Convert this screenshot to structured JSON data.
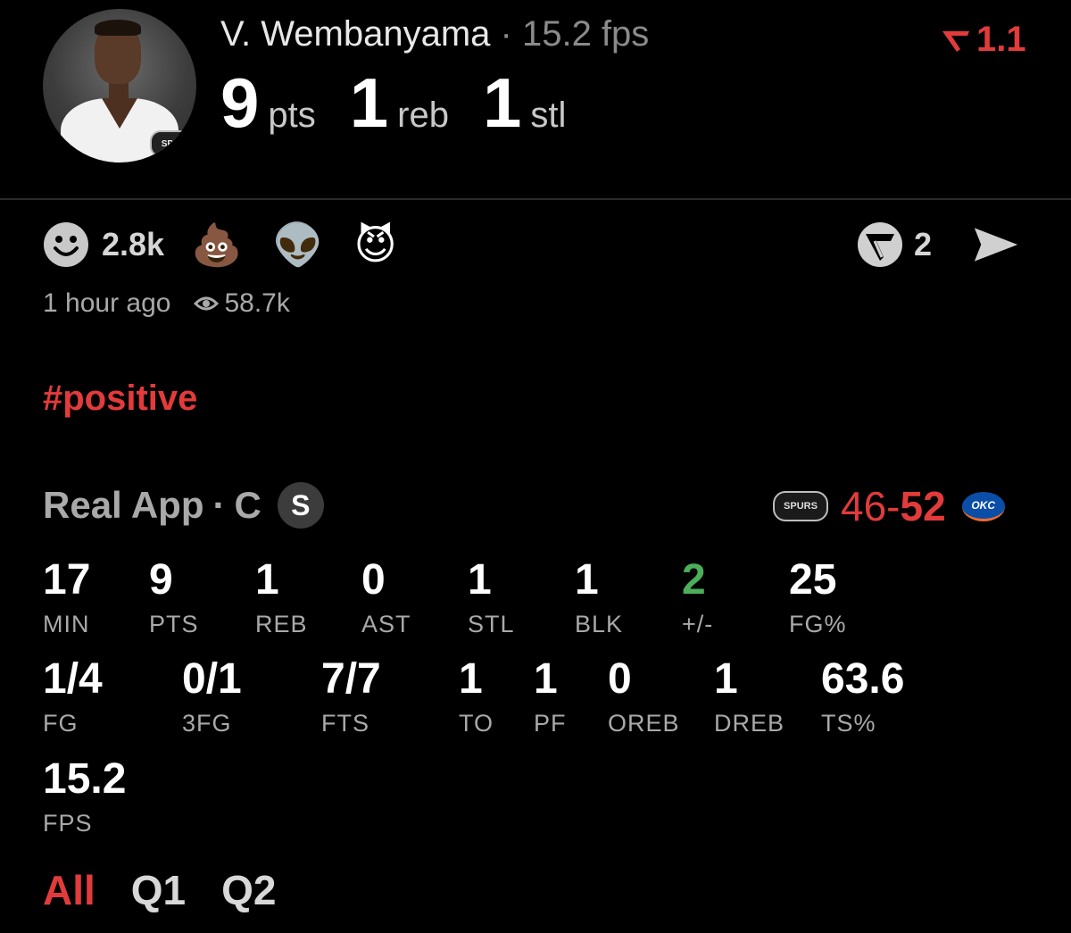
{
  "player": {
    "name": "V. Wembanyama",
    "separator": "·",
    "fps_text": "15.2 fps",
    "headline": [
      {
        "value": "9",
        "label": "pts"
      },
      {
        "value": "1",
        "label": "reb"
      },
      {
        "value": "1",
        "label": "stl"
      }
    ],
    "avatar_badge": "SPURS",
    "v_rating": "1.1"
  },
  "reactions": {
    "smiley_count": "2.8k",
    "emojis": [
      "💩",
      "👽",
      "😈"
    ],
    "share_count": "2",
    "timestamp": "1 hour ago",
    "views": "58.7k"
  },
  "post": {
    "hashtag": "#positive"
  },
  "game": {
    "source": "Real App",
    "separator": "·",
    "position": "C",
    "starter_badge": "S",
    "home_logo": "SPURS",
    "away_logo": "OKC",
    "score_left": "46",
    "score_dash": "-",
    "score_right": "52"
  },
  "stats_row1": [
    {
      "value": "17",
      "label": "MIN"
    },
    {
      "value": "9",
      "label": "PTS"
    },
    {
      "value": "1",
      "label": "REB"
    },
    {
      "value": "0",
      "label": "AST"
    },
    {
      "value": "1",
      "label": "STL"
    },
    {
      "value": "1",
      "label": "BLK"
    },
    {
      "value": "2",
      "label": "+/-"
    },
    {
      "value": "25",
      "label": "FG%"
    }
  ],
  "stats_row2": [
    {
      "value": "1/4",
      "label": "FG"
    },
    {
      "value": "0/1",
      "label": "3FG"
    },
    {
      "value": "7/7",
      "label": "FTS"
    },
    {
      "value": "1",
      "label": "TO"
    },
    {
      "value": "1",
      "label": "PF"
    },
    {
      "value": "0",
      "label": "OREB"
    },
    {
      "value": "1",
      "label": "DREB"
    },
    {
      "value": "63.6",
      "label": "TS%"
    }
  ],
  "stats_row3": [
    {
      "value": "15.2",
      "label": "FPS"
    }
  ],
  "tabs": [
    "All",
    "Q1",
    "Q2"
  ],
  "colors": {
    "accent_red": "#e23b3b",
    "positive_green": "#4cae5b",
    "muted_gray": "#a9a9a9"
  }
}
